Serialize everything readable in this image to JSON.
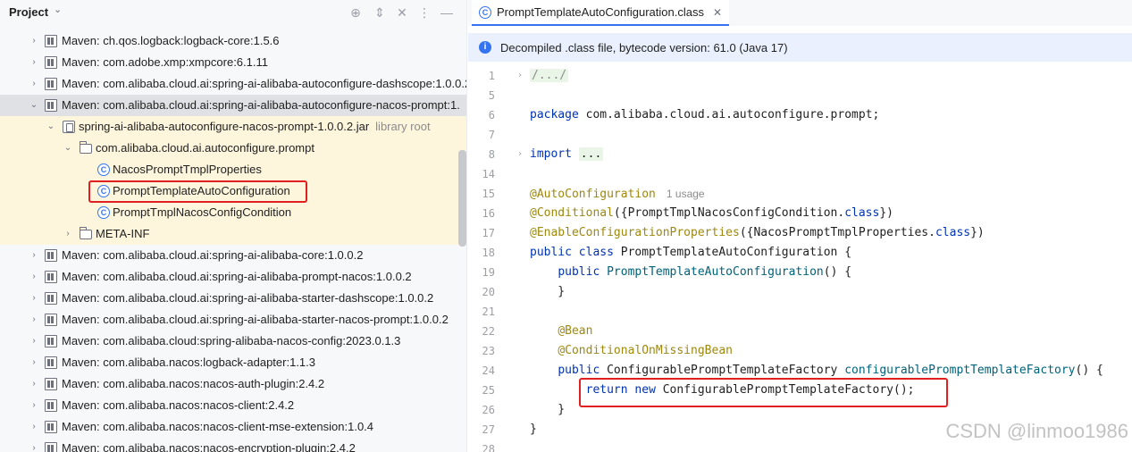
{
  "project": {
    "title": "Project",
    "tree": [
      {
        "label": "Maven: ch.qos.logback:logback-core:1.5.6",
        "type": "maven",
        "arrow": "›"
      },
      {
        "label": "Maven: com.adobe.xmp:xmpcore:6.1.11",
        "type": "maven",
        "arrow": "›"
      },
      {
        "label": "Maven: com.alibaba.cloud.ai:spring-ai-alibaba-autoconfigure-dashscope:1.0.0.2",
        "type": "maven",
        "arrow": "›"
      },
      {
        "label": "Maven: com.alibaba.cloud.ai:spring-ai-alibaba-autoconfigure-nacos-prompt:1.",
        "type": "maven",
        "arrow": "⌄",
        "selected": true
      },
      {
        "label": "spring-ai-alibaba-autoconfigure-nacos-prompt-1.0.0.2.jar",
        "sub": "library root",
        "type": "jar",
        "arrow": "⌄"
      },
      {
        "label": "com.alibaba.cloud.ai.autoconfigure.prompt",
        "type": "folder",
        "arrow": "⌄"
      },
      {
        "label": "NacosPromptTmplProperties",
        "type": "class"
      },
      {
        "label": "PromptTemplateAutoConfiguration",
        "type": "class"
      },
      {
        "label": "PromptTmplNacosConfigCondition",
        "type": "class"
      },
      {
        "label": "META-INF",
        "type": "folder",
        "arrow": "›"
      },
      {
        "label": "Maven: com.alibaba.cloud.ai:spring-ai-alibaba-core:1.0.0.2",
        "type": "maven",
        "arrow": "›"
      },
      {
        "label": "Maven: com.alibaba.cloud.ai:spring-ai-alibaba-prompt-nacos:1.0.0.2",
        "type": "maven",
        "arrow": "›"
      },
      {
        "label": "Maven: com.alibaba.cloud.ai:spring-ai-alibaba-starter-dashscope:1.0.0.2",
        "type": "maven",
        "arrow": "›"
      },
      {
        "label": "Maven: com.alibaba.cloud.ai:spring-ai-alibaba-starter-nacos-prompt:1.0.0.2",
        "type": "maven",
        "arrow": "›"
      },
      {
        "label": "Maven: com.alibaba.cloud:spring-alibaba-nacos-config:2023.0.1.3",
        "type": "maven",
        "arrow": "›"
      },
      {
        "label": "Maven: com.alibaba.nacos:logback-adapter:1.1.3",
        "type": "maven",
        "arrow": "›"
      },
      {
        "label": "Maven: com.alibaba.nacos:nacos-auth-plugin:2.4.2",
        "type": "maven",
        "arrow": "›"
      },
      {
        "label": "Maven: com.alibaba.nacos:nacos-client:2.4.2",
        "type": "maven",
        "arrow": "›"
      },
      {
        "label": "Maven: com.alibaba.nacos:nacos-client-mse-extension:1.0.4",
        "type": "maven",
        "arrow": "›"
      },
      {
        "label": "Maven: com.alibaba.nacos:nacos-encryption-plugin:2.4.2",
        "type": "maven",
        "arrow": "›"
      }
    ]
  },
  "editor": {
    "tab_label": "PromptTemplateAutoConfiguration.class",
    "info_text": "Decompiled .class file, bytecode version: 61.0 (Java 17)",
    "lines": [
      {
        "n": "1",
        "fold": "›",
        "segs": [
          {
            "t": "/.../",
            "c": "cmt fold-region"
          }
        ]
      },
      {
        "n": "5",
        "segs": []
      },
      {
        "n": "6",
        "segs": [
          {
            "t": "package",
            "c": "kw"
          },
          {
            "t": " com.alibaba.cloud.ai.autoconfigure.prompt;",
            "c": ""
          }
        ]
      },
      {
        "n": "7",
        "segs": []
      },
      {
        "n": "8",
        "fold": "›",
        "segs": [
          {
            "t": "import",
            "c": "kw"
          },
          {
            "t": " ",
            "c": ""
          },
          {
            "t": "...",
            "c": "fold-region"
          }
        ]
      },
      {
        "n": "14",
        "segs": []
      },
      {
        "n": "15",
        "segs": [
          {
            "t": "@AutoConfiguration",
            "c": "ann"
          }
        ],
        "usage": "1 usage"
      },
      {
        "n": "16",
        "segs": [
          {
            "t": "@Conditional",
            "c": "ann"
          },
          {
            "t": "({PromptTmplNacosConfigCondition.",
            "c": ""
          },
          {
            "t": "class",
            "c": "kw"
          },
          {
            "t": "})",
            "c": ""
          }
        ]
      },
      {
        "n": "17",
        "segs": [
          {
            "t": "@EnableConfigurationProperties",
            "c": "ann"
          },
          {
            "t": "({NacosPromptTmplProperties.",
            "c": ""
          },
          {
            "t": "class",
            "c": "kw"
          },
          {
            "t": "})",
            "c": ""
          }
        ]
      },
      {
        "n": "18",
        "segs": [
          {
            "t": "public class",
            "c": "kw"
          },
          {
            "t": " PromptTemplateAutoConfiguration {",
            "c": ""
          }
        ]
      },
      {
        "n": "19",
        "segs": [
          {
            "t": "    ",
            "c": ""
          },
          {
            "t": "public",
            "c": "kw"
          },
          {
            "t": " ",
            "c": ""
          },
          {
            "t": "PromptTemplateAutoConfiguration",
            "c": "mth"
          },
          {
            "t": "() {",
            "c": ""
          }
        ]
      },
      {
        "n": "20",
        "segs": [
          {
            "t": "    }",
            "c": ""
          }
        ]
      },
      {
        "n": "21",
        "segs": []
      },
      {
        "n": "22",
        "segs": [
          {
            "t": "    ",
            "c": ""
          },
          {
            "t": "@Bean",
            "c": "ann"
          }
        ]
      },
      {
        "n": "23",
        "segs": [
          {
            "t": "    ",
            "c": ""
          },
          {
            "t": "@ConditionalOnMissingBean",
            "c": "ann"
          }
        ]
      },
      {
        "n": "24",
        "segs": [
          {
            "t": "    ",
            "c": ""
          },
          {
            "t": "public",
            "c": "kw"
          },
          {
            "t": " ConfigurablePromptTemplateFactory ",
            "c": ""
          },
          {
            "t": "configurablePromptTemplateFactory",
            "c": "mth"
          },
          {
            "t": "() {",
            "c": ""
          }
        ]
      },
      {
        "n": "25",
        "segs": [
          {
            "t": "        ",
            "c": ""
          },
          {
            "t": "return new",
            "c": "kw"
          },
          {
            "t": " ConfigurablePromptTemplateFactory();",
            "c": ""
          }
        ]
      },
      {
        "n": "26",
        "segs": [
          {
            "t": "    }",
            "c": ""
          }
        ]
      },
      {
        "n": "27",
        "segs": [
          {
            "t": "}",
            "c": ""
          }
        ]
      },
      {
        "n": "28",
        "segs": []
      }
    ]
  },
  "watermark": "CSDN @linmoo1986"
}
